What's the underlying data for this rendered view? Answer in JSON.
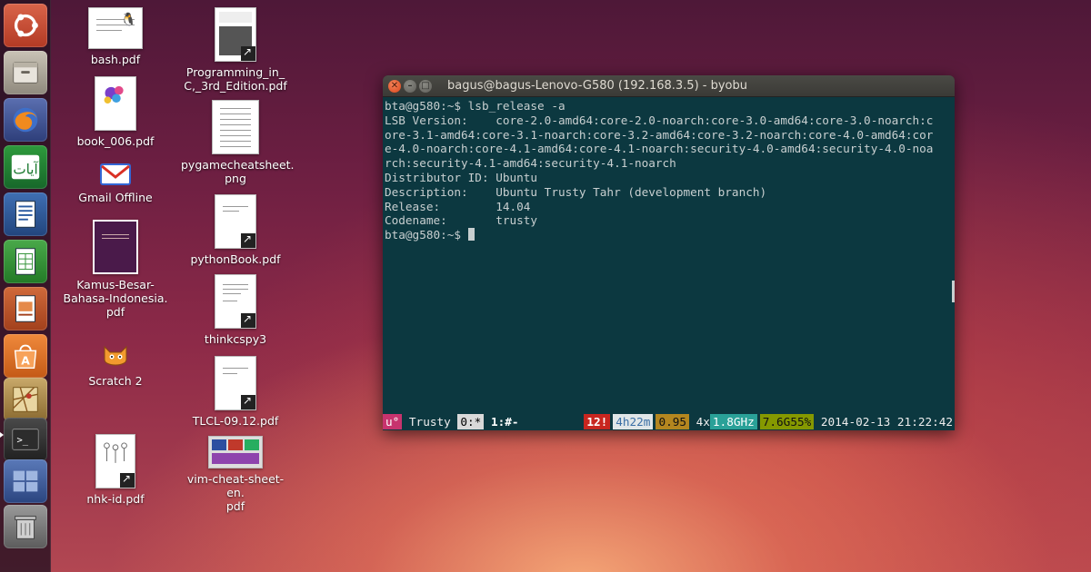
{
  "launcher": {
    "items": [
      {
        "name": "dash-home-icon"
      },
      {
        "name": "files-icon"
      },
      {
        "name": "firefox-icon"
      },
      {
        "name": "quran-app-icon"
      },
      {
        "name": "writer-icon"
      },
      {
        "name": "calc-icon"
      },
      {
        "name": "impress-icon"
      },
      {
        "name": "software-center-icon"
      },
      {
        "name": "maps-icon"
      },
      {
        "name": "terminal-icon"
      },
      {
        "name": "workspace-switcher-icon"
      },
      {
        "name": "trash-icon"
      }
    ]
  },
  "desktop": {
    "icons": [
      {
        "label": "bash.pdf"
      },
      {
        "label": "book_006.pdf"
      },
      {
        "label": "Gmail Offline"
      },
      {
        "label": "Kamus-Besar-\nBahasa-Indonesia.\npdf"
      },
      {
        "label": "Scratch 2"
      },
      {
        "label": "nhk-id.pdf"
      },
      {
        "label": "Programming_in_\nC,_3rd_Edition.pdf"
      },
      {
        "label": "pygamecheatsheet.\npng"
      },
      {
        "label": "pythonBook.pdf"
      },
      {
        "label": "thinkcspy3"
      },
      {
        "label": "TLCL-09.12.pdf"
      },
      {
        "label": "vim-cheat-sheet-en.\npdf"
      }
    ]
  },
  "terminal": {
    "title": "bagus@bagus-Lenovo-G580 (192.168.3.5) - byobu",
    "close_glyph": "✕",
    "min_glyph": "–",
    "max_glyph": "□",
    "lines": [
      "bta@g580:~$ lsb_release -a",
      "LSB Version:    core-2.0-amd64:core-2.0-noarch:core-3.0-amd64:core-3.0-noarch:c",
      "ore-3.1-amd64:core-3.1-noarch:core-3.2-amd64:core-3.2-noarch:core-4.0-amd64:cor",
      "e-4.0-noarch:core-4.1-amd64:core-4.1-noarch:security-4.0-amd64:security-4.0-noa",
      "rch:security-4.1-amd64:security-4.1-noarch",
      "Distributor ID: Ubuntu",
      "Description:    Ubuntu Trusty Tahr (development branch)",
      "Release:        14.04",
      "Codename:       trusty"
    ],
    "prompt": "bta@g580:~$ ",
    "status": {
      "logo": "u°",
      "release": " Trusty ",
      "session": "0:*",
      "window": " 1:#- ",
      "updates": "12!",
      "uptime": "4h22m",
      "load": "0.95",
      "cpu_count": " 4x",
      "cpu_freq": "1.8GHz",
      "mem": "7.6G55%",
      "datetime": " 2014-02-13 21:22:42"
    },
    "colors": {
      "background": "#0c3840",
      "logo_bg": "#c7336e",
      "updates_bg": "#c8261f",
      "load_bg": "#b4861f",
      "cpu_bg": "#2aa198",
      "mem_bg": "#859900"
    }
  }
}
